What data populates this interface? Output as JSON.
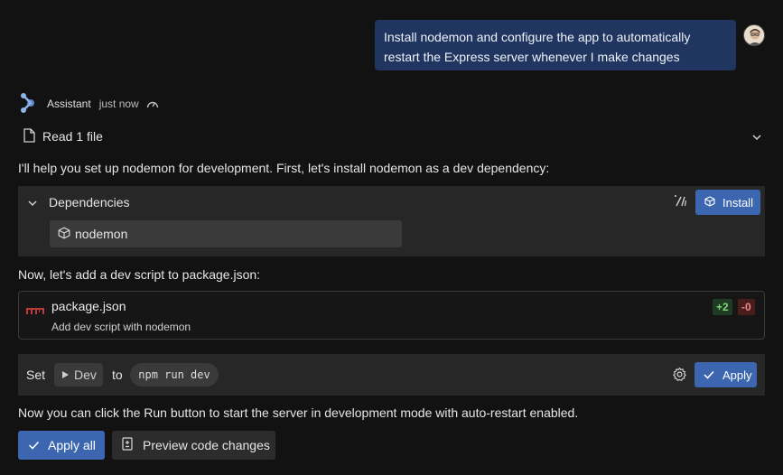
{
  "user_message": "Install nodemon and configure the app to automatically restart the Express server whenever I make changes",
  "assistant": {
    "name": "Assistant",
    "time": "just now"
  },
  "read_files": {
    "label": "Read 1 file"
  },
  "intro_text": "I'll help you set up nodemon for development. First, let's install nodemon as a dev dependency:",
  "dependencies": {
    "title": "Dependencies",
    "install_label": "Install",
    "items": [
      "nodemon"
    ]
  },
  "script_text": "Now, let's add a dev script to package.json:",
  "file_change": {
    "file_name": "package.json",
    "description": "Add dev script with nodemon",
    "additions": "+2",
    "deletions": "-0"
  },
  "run_config": {
    "set_label": "Set",
    "run_name": "Dev",
    "to_label": "to",
    "command": "npm run dev",
    "apply_label": "Apply"
  },
  "closing_text": "Now you can click the Run button to start the server in development mode with auto-restart enabled.",
  "actions": {
    "apply_all_label": "Apply all",
    "preview_label": "Preview code changes"
  },
  "colors": {
    "background": "#121212",
    "user_bubble": "#203560",
    "accent": "#3c67b0",
    "card": "#272727",
    "diff_add": "#7fd47f",
    "diff_del": "#f08a8a"
  }
}
